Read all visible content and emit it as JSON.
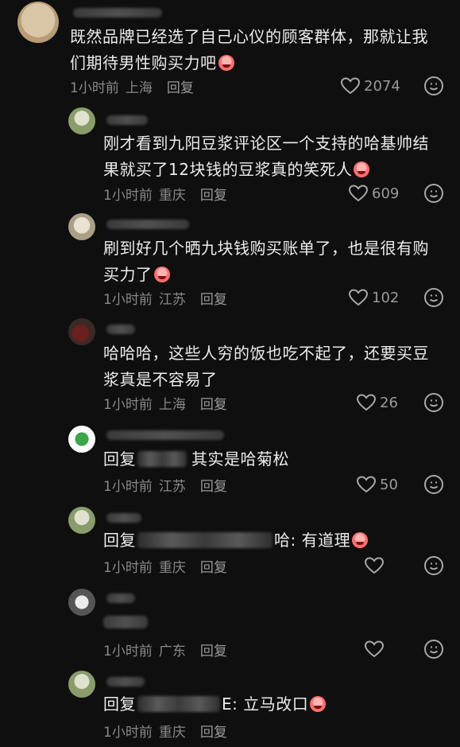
{
  "comments": [
    {
      "text": "既然品牌已经选了自己心仪的顾客群体，那就让我们期待男性购买力吧",
      "time": "1小时前",
      "location": "上海",
      "reply": "回复",
      "likes": "2074"
    },
    {
      "text": "刚才看到九阳豆浆评论区一个支持的哈基帅结果就买了12块钱的豆浆真的笑死人",
      "time": "1小时前",
      "location": "重庆",
      "reply": "回复",
      "likes": "609"
    },
    {
      "text": "刷到好几个晒九块钱购买账单了，也是很有购买力了",
      "time": "1小时前",
      "location": "江苏",
      "reply": "回复",
      "likes": "102"
    },
    {
      "text": "哈哈哈，这些人穷的饭也吃不起了，还要买豆浆真是不容易了",
      "time": "1小时前",
      "location": "上海",
      "reply": "回复",
      "likes": "26"
    },
    {
      "prefix": "回复",
      "text": "其实是哈菊松",
      "time": "1小时前",
      "location": "江苏",
      "reply": "回复",
      "likes": "50"
    },
    {
      "prefix": "回复",
      "suffix": "哈: 有道理",
      "time": "1小时前",
      "location": "重庆",
      "reply": "回复",
      "likes": ""
    },
    {
      "time": "1小时前",
      "location": "广东",
      "reply": "回复",
      "likes": ""
    },
    {
      "prefix": "回复",
      "suffix": "E: 立马改口",
      "time": "1小时前",
      "location": "重庆",
      "reply": "回复"
    }
  ],
  "icons": {
    "like": "heart-outline-icon",
    "reaction": "smiley-icon"
  },
  "colors": {
    "background": "#0f0f0f",
    "text": "#ececec",
    "meta": "#8a8a8a"
  }
}
